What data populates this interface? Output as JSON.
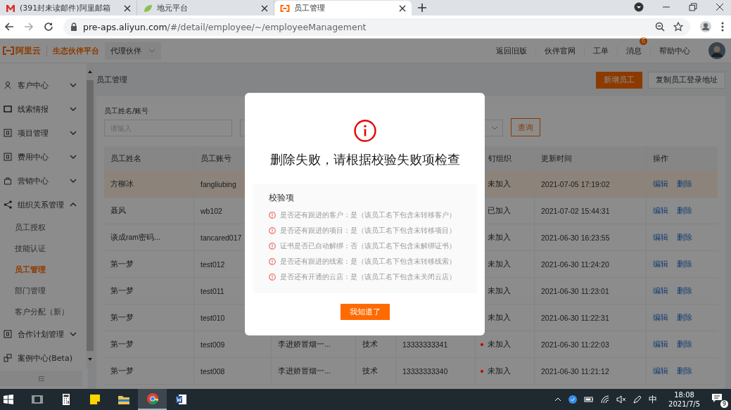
{
  "browser": {
    "tabs": [
      {
        "kind": "mail",
        "title": "(391封未读邮件)阿里邮箱",
        "selected": false
      },
      {
        "kind": "leaf",
        "title": "地元平台",
        "selected": false
      },
      {
        "kind": "cloud",
        "title": "员工管理",
        "selected": true
      }
    ],
    "url_host": "pre-aps.aliyun.com",
    "url_path": "/#/detail/employee/~/employeeManagement"
  },
  "header": {
    "logo": "阿里云",
    "platform": "生态伙伴平台",
    "role": "代理伙伴",
    "links": [
      {
        "label": "返回旧版"
      },
      {
        "label": "伙伴官网"
      },
      {
        "label": "工单"
      },
      {
        "label": "消息",
        "badge": "6"
      },
      {
        "label": "帮助中心"
      }
    ]
  },
  "sidebar": {
    "items": [
      {
        "kind": "people",
        "label": "客户中心",
        "expanded": false
      },
      {
        "kind": "frame",
        "label": "线索情报",
        "expanded": false
      },
      {
        "kind": "square",
        "label": "项目管理",
        "expanded": false
      },
      {
        "kind": "square",
        "label": "费用中心",
        "expanded": false
      },
      {
        "kind": "bag",
        "label": "营销中心",
        "expanded": false
      },
      {
        "kind": "share",
        "label": "组织关系管理",
        "expanded": true,
        "children": [
          {
            "label": "员工授权",
            "selected": false
          },
          {
            "label": "技能认证",
            "selected": false
          },
          {
            "label": "员工管理",
            "selected": true
          },
          {
            "label": "部门管理",
            "selected": false
          },
          {
            "label": "客户分配（新）",
            "selected": false
          }
        ]
      },
      {
        "kind": "square",
        "label": "合作计划管理",
        "expanded": false
      },
      {
        "kind": "cases",
        "label": "案例中心(Beta)"
      }
    ]
  },
  "page": {
    "title": "员工管理",
    "buttons": [
      {
        "kind": "primary",
        "label": "新增员工"
      },
      {
        "kind": "default",
        "label": "复制员工登录地址"
      }
    ]
  },
  "filter": {
    "label": "员工姓名/账号",
    "placeholder": "请输入",
    "button": "查询"
  },
  "table": {
    "columns": [
      {
        "label": "员工姓名"
      },
      {
        "label": "员工账号"
      },
      {
        "label": "钉组织"
      },
      {
        "label": "更新时间"
      },
      {
        "label": "操作"
      }
    ],
    "rows": [
      {
        "name": "方柳冰",
        "account": "fangliubing",
        "status": "未加入",
        "time": "2021-07-05 17:19:02",
        "actions": [
          "编辑",
          "删除"
        ],
        "selected": true
      },
      {
        "name": "聂风",
        "account": "wb102",
        "status": "已加入",
        "time": "2021-07-02 15:44:31",
        "actions": [
          "编辑",
          "删除"
        ],
        "selected": false
      },
      {
        "name": "谈成ram密码...",
        "account": "tancared017",
        "status": "未加入",
        "time": "2021-06-30 16:23:55",
        "actions": [
          "编辑",
          "删除"
        ],
        "selected": false
      },
      {
        "name": "第一梦",
        "account": "test012",
        "status": "未加入",
        "time": "2021-06-30 11:24:20",
        "actions": [
          "编辑",
          "删除"
        ],
        "selected": false
      },
      {
        "name": "第一梦",
        "account": "test011",
        "status": "未加入",
        "time": "2021-06-30 11:23:01",
        "actions": [
          "编辑",
          "删除"
        ],
        "selected": false
      },
      {
        "name": "第一梦",
        "account": "test010",
        "status": "未加入",
        "time": "2021-06-30 11:22:31",
        "actions": [
          "编辑",
          "删除"
        ],
        "selected": false
      },
      {
        "name": "第一梦",
        "account": "test009",
        "column_3": "李进娇冒烟一...",
        "column_4": "技术",
        "column_5": "13333333341",
        "status": "未加入",
        "color": "#c00000",
        "time": "2021-06-30 11:22:03",
        "actions": [
          "编辑",
          "删除"
        ],
        "selected": false
      },
      {
        "name": "第一梦",
        "account": "test008",
        "column_3": "李进娇冒烟一...",
        "column_4": "技术",
        "column_5": "13333333340",
        "status": "未加入",
        "color": "#c00000",
        "time": "2021-06-30 11:21:12",
        "actions": [
          "编辑",
          "删除"
        ],
        "selected": false
      }
    ]
  },
  "modal": {
    "title": "删除失败，请根据校验失败项检查",
    "section": "校验项",
    "items": [
      "是否还有跟进的客户：是（该员工名下包含未转移客户）",
      "是否还有跟进的项目：是（该员工名下包含未转移项目）",
      "证书是否已自动解绑：否（该员工名下包含未解绑证书）",
      "是否还有跟进的线索：是（该员工名下包含未转移线索）",
      "是否还有开通的云店：是（该员工名下包含未关闭云店）"
    ],
    "button": "我知道了"
  },
  "taskbar": {
    "apps": [
      {
        "kind": "taskview",
        "selected": false
      },
      {
        "kind": "calculator",
        "selected": false
      },
      {
        "kind": "notes",
        "selected": false
      },
      {
        "kind": "folder",
        "selected": false
      },
      {
        "kind": "browser",
        "selected": true
      },
      {
        "kind": "word",
        "selected": false
      }
    ],
    "ime": "中",
    "time": "18:08",
    "date": "2021/7/5",
    "notifications": "9"
  }
}
